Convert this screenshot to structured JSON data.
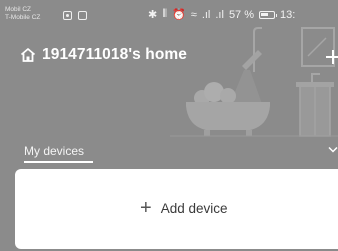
{
  "status_bar": {
    "carrier_line1": "Mobil CZ",
    "carrier_line2": "T-Mobile CZ",
    "bluetooth": "✱",
    "vibrate": "⦀",
    "alarm": "⏰",
    "wifi": "≈",
    "signal1": ".ıl",
    "signal2": ".ıl",
    "battery_percent": "57 %",
    "time": "13:"
  },
  "header": {
    "home_title": "1914711018's home"
  },
  "devices": {
    "tab_label": "My devices",
    "add_device_label": "Add device",
    "add_icon": "+"
  },
  "colors": {
    "overlay": "#8b8b8b",
    "card": "#ffffff",
    "accent_text": "#ffffff"
  }
}
